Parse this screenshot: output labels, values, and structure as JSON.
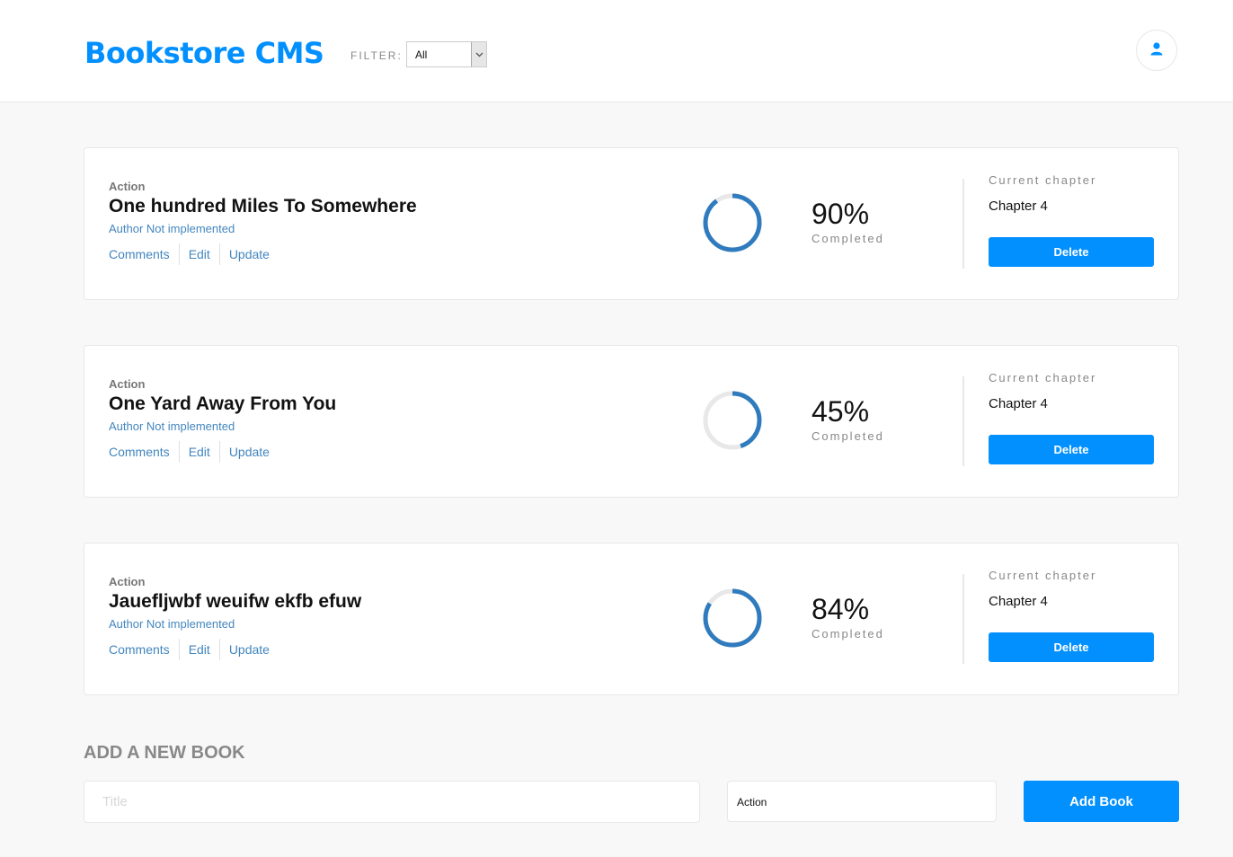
{
  "header": {
    "brand": "Bookstore CMS",
    "filter_label": "FILTER:",
    "filter_value": "All",
    "user_icon": "user-icon"
  },
  "books": [
    {
      "genre": "Action",
      "title": "One hundred Miles To Somewhere",
      "author": "Author Not implemented",
      "actions": [
        "Comments",
        "Edit",
        "Update"
      ],
      "progress": 0.9,
      "percent": "90%",
      "completed_label": "Completed",
      "current_chapter_label": "Current chapter",
      "current_chapter": "Chapter 4",
      "delete_label": "Delete"
    },
    {
      "genre": "Action",
      "title": "One Yard Away From You",
      "author": "Author Not implemented",
      "actions": [
        "Comments",
        "Edit",
        "Update"
      ],
      "progress": 0.45,
      "percent": "45%",
      "completed_label": "Completed",
      "current_chapter_label": "Current chapter",
      "current_chapter": "Chapter 4",
      "delete_label": "Delete"
    },
    {
      "genre": "Action",
      "title": "Jauefljwbf weuifw ekfb efuw",
      "author": "Author Not implemented",
      "actions": [
        "Comments",
        "Edit",
        "Update"
      ],
      "progress": 0.84,
      "percent": "84%",
      "completed_label": "Completed",
      "current_chapter_label": "Current chapter",
      "current_chapter": "Chapter 4",
      "delete_label": "Delete"
    }
  ],
  "add_form": {
    "heading": "ADD A NEW BOOK",
    "title_placeholder": "Title",
    "title_value": "",
    "category_value": "Action",
    "submit_label": "Add Book"
  },
  "colors": {
    "accent": "#0290ff",
    "link": "#4386bf",
    "ring_track": "#e8e8e8",
    "ring_fill": "#307bbe"
  }
}
